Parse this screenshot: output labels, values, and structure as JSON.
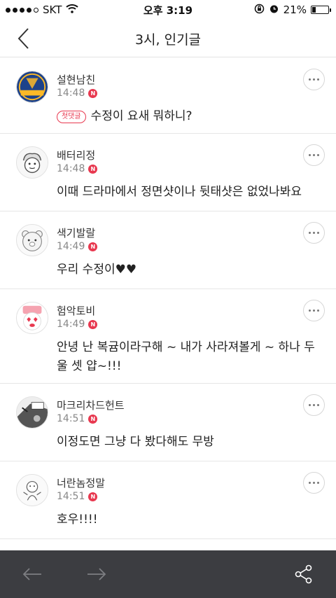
{
  "status_bar": {
    "carrier": "SKT",
    "time": "오후 3:19",
    "battery": "21%",
    "battery_level": 0.21,
    "signal_bars": 4
  },
  "header": {
    "title": "3시, 인기글",
    "back_icon": "chevron-left-icon"
  },
  "first_comment_badge": "첫댓글",
  "new_badge": "N",
  "comments": [
    {
      "author": "설현남친",
      "time": "14:48",
      "text": "수정이 요새 뭐하니?",
      "first": true,
      "avatar": "warriors-logo"
    },
    {
      "author": "배터리정",
      "time": "14:48",
      "text": "이때 드라마에서 정면샷이나 뒷태샷은 없었나봐요",
      "avatar": "cartoon-sketch"
    },
    {
      "author": "색기발랄",
      "time": "14:49",
      "text": "우리 수정이♥♥",
      "avatar": "bear-face"
    },
    {
      "author": "험악토비",
      "time": "14:49",
      "text": "안녕 난 복귬이라구해 ~ 내가 사라져볼게 ~ 하나 두울 셋 얍~!!!",
      "avatar": "heart-eyes-character"
    },
    {
      "author": "마크리차드헌트",
      "time": "14:51",
      "text": "이정도면 그냥 다 봤다해도 무방",
      "avatar": "comic-panel"
    },
    {
      "author": "너란놈정말",
      "time": "14:51",
      "text": "호우!!!!",
      "avatar": "doodle-person"
    }
  ],
  "bottom_bar": {
    "back_icon": "arrow-left-icon",
    "forward_icon": "arrow-right-icon",
    "share_icon": "share-icon"
  },
  "colors": {
    "accent_red": "#e8384f",
    "bottom_bar_bg": "#3c3d41"
  }
}
